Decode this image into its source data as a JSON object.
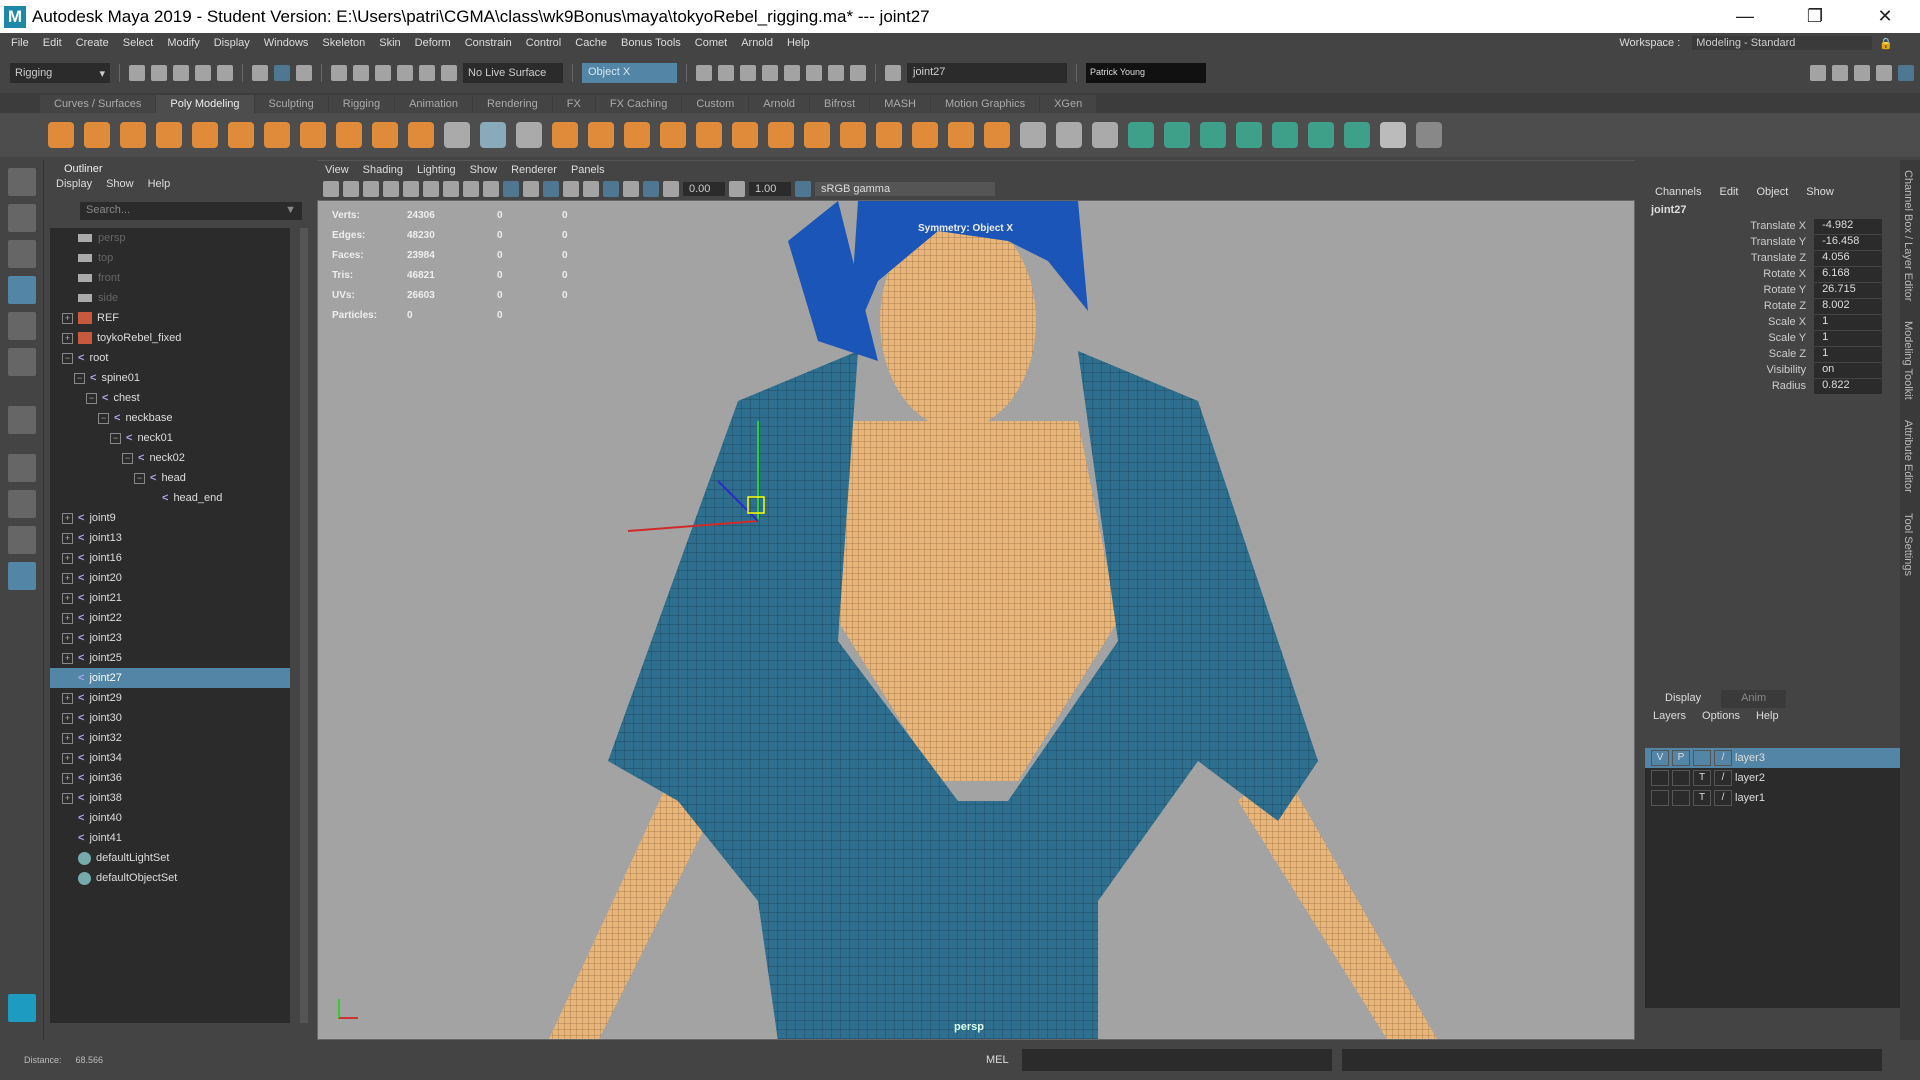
{
  "window": {
    "app_icon": "maya-logo-icon",
    "title": "Autodesk Maya 2019 - Student Version: E:\\Users\\patri\\CGMA\\class\\wk9Bonus\\maya\\tokyoRebel_rigging.ma*  ---  joint27",
    "controls": [
      "minimize",
      "restore",
      "close"
    ]
  },
  "menubar": {
    "items": [
      "File",
      "Edit",
      "Create",
      "Select",
      "Modify",
      "Display",
      "Windows",
      "Skeleton",
      "Skin",
      "Deform",
      "Constrain",
      "Control",
      "Cache",
      "Bonus Tools",
      "Comet",
      "Arnold",
      "Help"
    ],
    "workspace_label": "Workspace :",
    "workspace_value": "Modeling - Standard"
  },
  "statusline": {
    "menuset": "Rigging",
    "live_surface": "No Live Surface",
    "symmetry": "Object X",
    "name_field": "joint27",
    "user": "Patrick Young"
  },
  "shelf": {
    "tabs": [
      "Curves / Surfaces",
      "Poly Modeling",
      "Sculpting",
      "Rigging",
      "Animation",
      "Rendering",
      "FX",
      "FX Caching",
      "Custom",
      "Arnold",
      "Bifrost",
      "MASH",
      "Motion Graphics",
      "XGen"
    ],
    "active_tab": "Poly Modeling"
  },
  "outliner": {
    "title": "Outliner",
    "menu": [
      "Display",
      "Show",
      "Help"
    ],
    "search_placeholder": "Search...",
    "items": [
      {
        "label": "persp",
        "type": "camera",
        "depth": 0,
        "expander": "none"
      },
      {
        "label": "top",
        "type": "camera",
        "depth": 0,
        "expander": "none"
      },
      {
        "label": "front",
        "type": "camera",
        "depth": 0,
        "expander": "none"
      },
      {
        "label": "side",
        "type": "camera",
        "depth": 0,
        "expander": "none"
      },
      {
        "label": "REF",
        "type": "reference",
        "depth": 0,
        "expander": "plus"
      },
      {
        "label": "toykoRebel_fixed",
        "type": "reference",
        "depth": 0,
        "expander": "plus"
      },
      {
        "label": "root",
        "type": "joint",
        "depth": 0,
        "expander": "minus"
      },
      {
        "label": "spine01",
        "type": "joint",
        "depth": 1,
        "expander": "minus"
      },
      {
        "label": "chest",
        "type": "joint",
        "depth": 2,
        "expander": "minus"
      },
      {
        "label": "neckbase",
        "type": "joint",
        "depth": 3,
        "expander": "minus"
      },
      {
        "label": "neck01",
        "type": "joint",
        "depth": 4,
        "expander": "minus"
      },
      {
        "label": "neck02",
        "type": "joint",
        "depth": 5,
        "expander": "minus"
      },
      {
        "label": "head",
        "type": "joint",
        "depth": 6,
        "expander": "minus"
      },
      {
        "label": "head_end",
        "type": "joint",
        "depth": 7,
        "expander": "none"
      },
      {
        "label": "joint9",
        "type": "joint",
        "depth": 0,
        "expander": "plus"
      },
      {
        "label": "joint13",
        "type": "joint",
        "depth": 0,
        "expander": "plus"
      },
      {
        "label": "joint16",
        "type": "joint",
        "depth": 0,
        "expander": "plus"
      },
      {
        "label": "joint20",
        "type": "joint",
        "depth": 0,
        "expander": "plus"
      },
      {
        "label": "joint21",
        "type": "joint",
        "depth": 0,
        "expander": "plus"
      },
      {
        "label": "joint22",
        "type": "joint",
        "depth": 0,
        "expander": "plus"
      },
      {
        "label": "joint23",
        "type": "joint",
        "depth": 0,
        "expander": "plus"
      },
      {
        "label": "joint25",
        "type": "joint",
        "depth": 0,
        "expander": "plus"
      },
      {
        "label": "joint27",
        "type": "joint",
        "depth": 0,
        "expander": "none",
        "selected": true
      },
      {
        "label": "joint29",
        "type": "joint",
        "depth": 0,
        "expander": "plus"
      },
      {
        "label": "joint30",
        "type": "joint",
        "depth": 0,
        "expander": "plus"
      },
      {
        "label": "joint32",
        "type": "joint",
        "depth": 0,
        "expander": "plus"
      },
      {
        "label": "joint34",
        "type": "joint",
        "depth": 0,
        "expander": "plus"
      },
      {
        "label": "joint36",
        "type": "joint",
        "depth": 0,
        "expander": "plus"
      },
      {
        "label": "joint38",
        "type": "joint",
        "depth": 0,
        "expander": "plus"
      },
      {
        "label": "joint40",
        "type": "joint",
        "depth": 0,
        "expander": "none"
      },
      {
        "label": "joint41",
        "type": "joint",
        "depth": 0,
        "expander": "none"
      },
      {
        "label": "defaultLightSet",
        "type": "set",
        "depth": 0,
        "expander": "none"
      },
      {
        "label": "defaultObjectSet",
        "type": "set",
        "depth": 0,
        "expander": "none"
      }
    ]
  },
  "viewport": {
    "menu": [
      "View",
      "Shading",
      "Lighting",
      "Show",
      "Renderer",
      "Panels"
    ],
    "exposure": "0.00",
    "gamma_value": "1.00",
    "color_space": "sRGB gamma",
    "hud": [
      {
        "label": "Verts:",
        "v1": "24306",
        "v2": "0",
        "v3": "0"
      },
      {
        "label": "Edges:",
        "v1": "48230",
        "v2": "0",
        "v3": "0"
      },
      {
        "label": "Faces:",
        "v1": "23984",
        "v2": "0",
        "v3": "0"
      },
      {
        "label": "Tris:",
        "v1": "46821",
        "v2": "0",
        "v3": "0"
      },
      {
        "label": "UVs:",
        "v1": "26603",
        "v2": "0",
        "v3": "0"
      },
      {
        "label": "Particles:",
        "v1": "0",
        "v2": "0",
        "v3": ""
      }
    ],
    "symmetry_label": "Symmetry: Object X",
    "camera_label": "persp"
  },
  "channelbox": {
    "menu": [
      "Channels",
      "Edit",
      "Object",
      "Show"
    ],
    "object": "joint27",
    "attrs": [
      {
        "label": "Translate X",
        "value": "-4.982"
      },
      {
        "label": "Translate Y",
        "value": "-16.458"
      },
      {
        "label": "Translate Z",
        "value": "4.056"
      },
      {
        "label": "Rotate X",
        "value": "6.168"
      },
      {
        "label": "Rotate Y",
        "value": "26.715"
      },
      {
        "label": "Rotate Z",
        "value": "8.002"
      },
      {
        "label": "Scale X",
        "value": "1"
      },
      {
        "label": "Scale Y",
        "value": "1"
      },
      {
        "label": "Scale Z",
        "value": "1"
      },
      {
        "label": "Visibility",
        "value": "on"
      },
      {
        "label": "Radius",
        "value": "0.822"
      }
    ]
  },
  "side_tabs": [
    "Channel Box / Layer Editor",
    "Modeling Toolkit",
    "Attribute Editor",
    "Tool Settings"
  ],
  "layer_editor": {
    "tabs": [
      "Display",
      "Anim"
    ],
    "menu": [
      "Layers",
      "Options",
      "Help"
    ],
    "layers": [
      {
        "name": "layer3",
        "v": "V",
        "p": "P",
        "t": "",
        "selected": true
      },
      {
        "name": "layer2",
        "v": "",
        "p": "",
        "t": "T"
      },
      {
        "name": "layer1",
        "v": "",
        "p": "",
        "t": "T"
      }
    ]
  },
  "bottombar": {
    "distance_label": "Distance:",
    "distance_value": "68.566",
    "mel_label": "MEL"
  },
  "colors": {
    "accent": "#5285a6",
    "shelf_orange": "#e08b3a",
    "shelf_teal": "#3fa08a",
    "joint_icon": "#a9a6e6",
    "viewport_bg": "#a3a3a3",
    "jacket": "#2e6f8f",
    "skin": "#e8b67a"
  }
}
